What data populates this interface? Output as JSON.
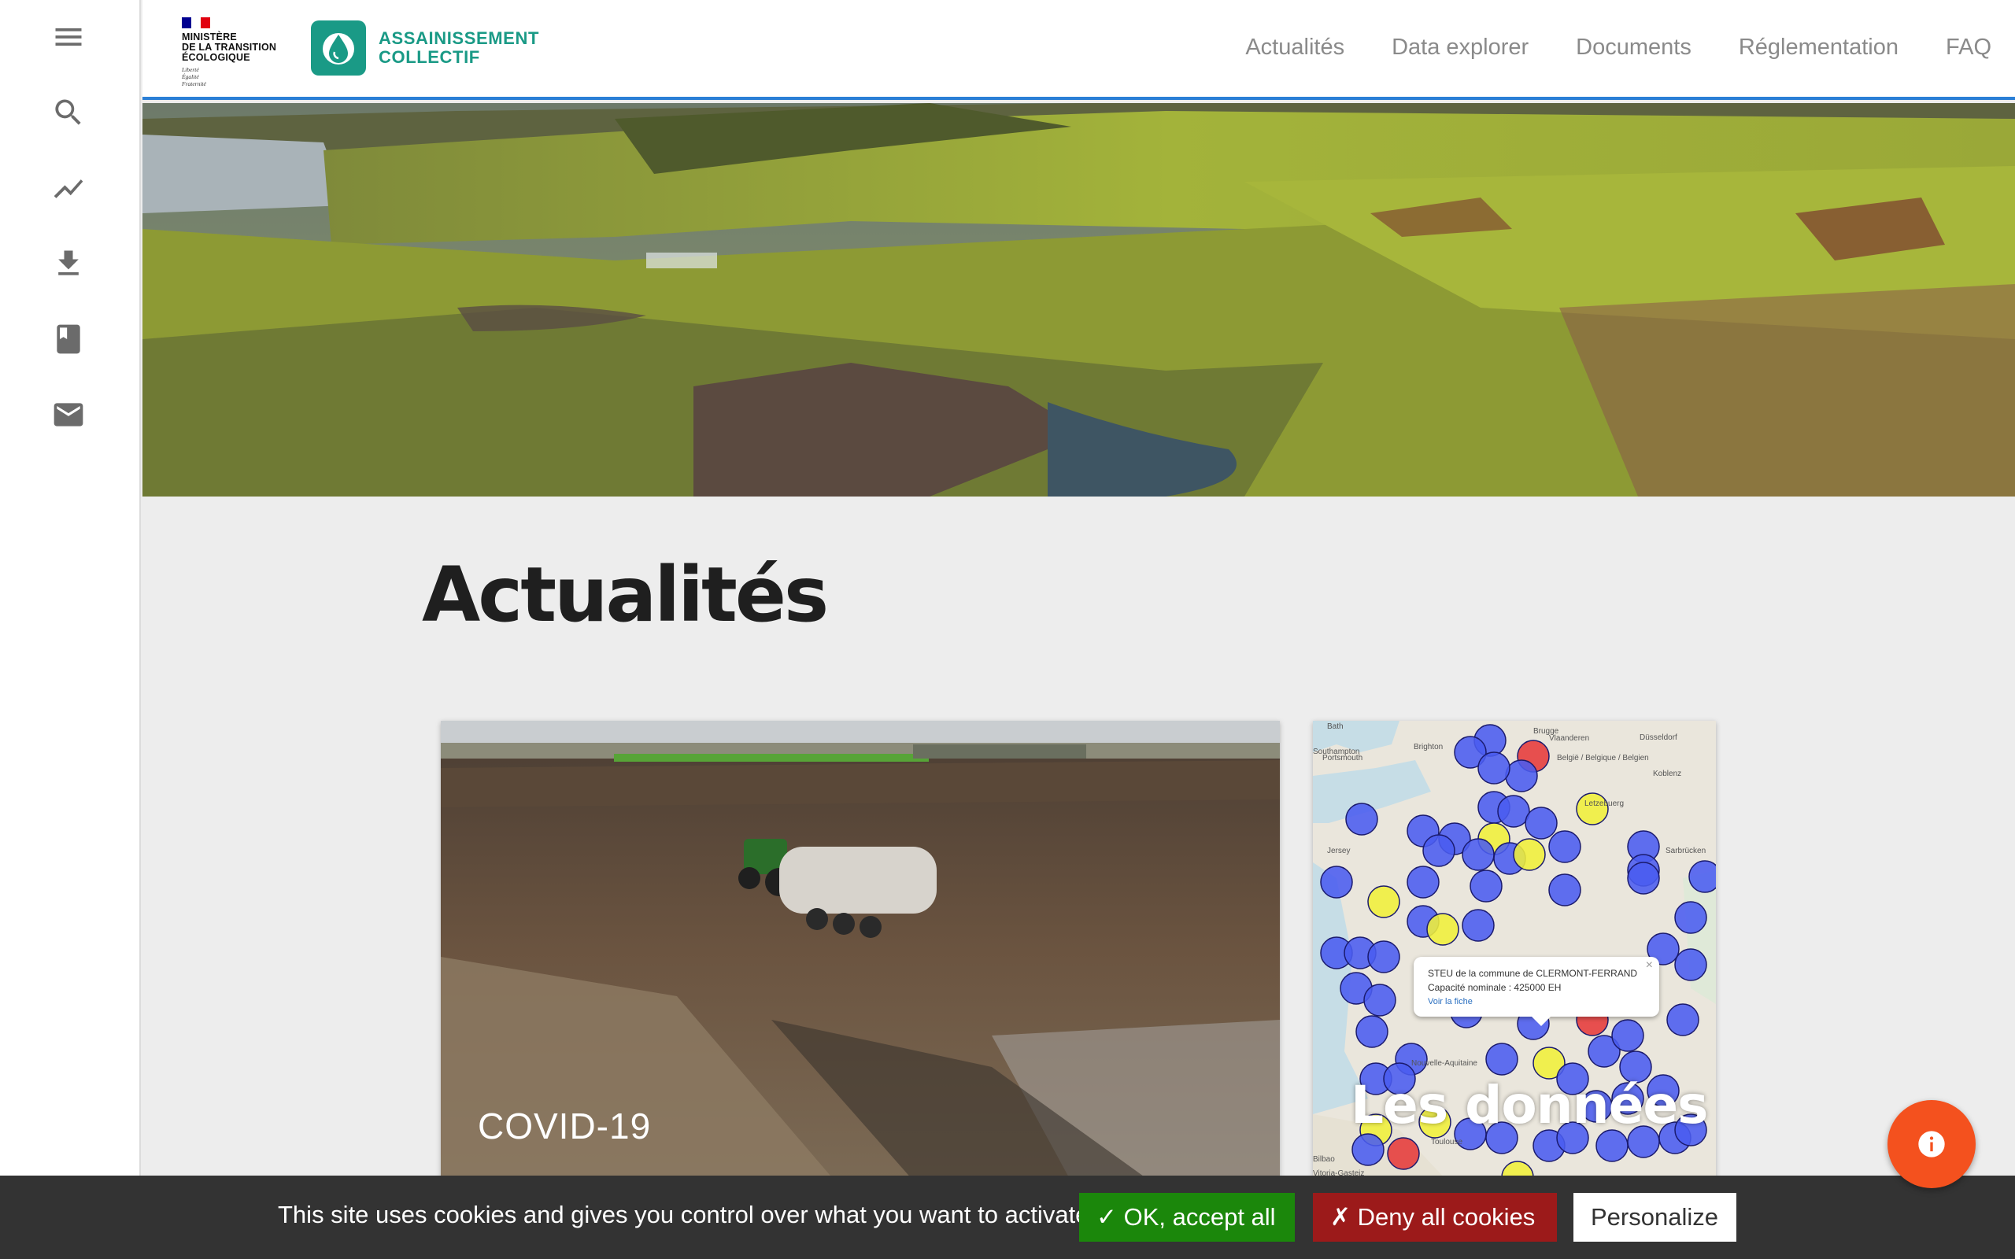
{
  "header": {
    "gov_logo": {
      "line1": "MINISTÈRE",
      "line2": "DE LA TRANSITION",
      "line3": "ÉCOLOGIQUE",
      "motto1": "Liberté",
      "motto2": "Égalité",
      "motto3": "Fraternité"
    },
    "brand": {
      "line1": "ASSAINISSEMENT",
      "line2": "COLLECTIF"
    },
    "nav": [
      "Actualités",
      "Data explorer",
      "Documents",
      "Réglementation",
      "FAQ"
    ]
  },
  "sidebar": {
    "items": [
      "menu-icon",
      "search-icon",
      "chart-icon",
      "download-icon",
      "book-icon",
      "mail-icon"
    ]
  },
  "main": {
    "title": "Actualités",
    "cards": [
      {
        "label": "COVID-19"
      },
      {
        "label": "Les données",
        "map_labels": [
          "Bath",
          "Brugge",
          "Düsseldorf",
          "Southampton",
          "Brighton",
          "Portsmouth",
          "Vlaanderen",
          "België / Belgique / Belgien",
          "Koblenz",
          "Letzebuerg",
          "Jersey",
          "Sarbrücken",
          "Nouvelle-Aquitaine",
          "Toulouse",
          "Bilbao",
          "Vitoria-Gasteiz"
        ],
        "popup": {
          "line1": "STEU de la commune de CLERMONT-FERRAND",
          "line2": "Capacité nominale : 425000 EH",
          "link": "Voir la fiche",
          "close": "×"
        }
      }
    ]
  },
  "cookie_banner": {
    "text": "This site uses cookies and gives you control over what you want to activate",
    "accept": "✓ OK, accept all",
    "deny": "✗ Deny all cookies",
    "personalize": "Personalize"
  },
  "colors": {
    "accent": "#2a7fd6",
    "brand": "#1a9a86",
    "accept": "#1b870b",
    "deny": "#9c1a1a",
    "fab": "#f4511e"
  }
}
